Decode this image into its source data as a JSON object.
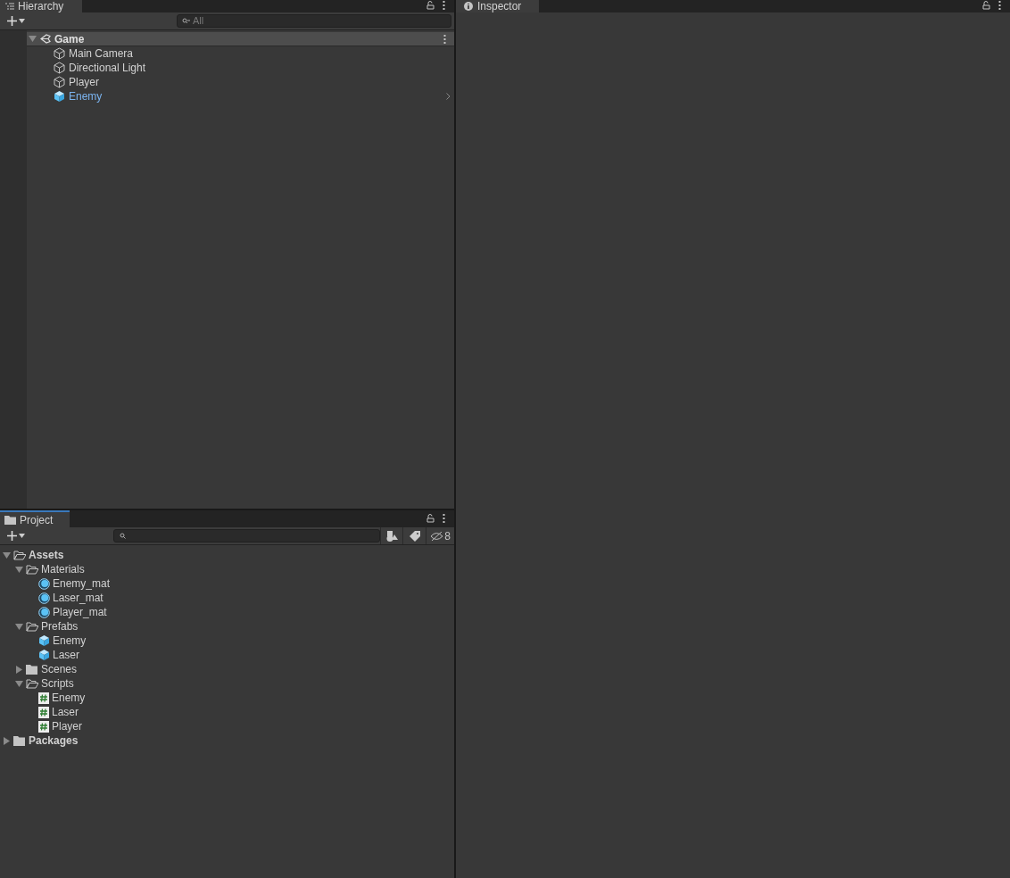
{
  "hierarchy": {
    "tab": "Hierarchy",
    "search": {
      "placeholder": "All"
    },
    "scene": {
      "name": "Game",
      "expanded": true
    },
    "items": [
      {
        "name": "Main Camera",
        "kind": "object"
      },
      {
        "name": "Directional Light",
        "kind": "object"
      },
      {
        "name": "Player",
        "kind": "object"
      },
      {
        "name": "Enemy",
        "kind": "prefab"
      }
    ]
  },
  "project": {
    "tab": "Project",
    "hidden_count": "8",
    "tree": [
      {
        "name": "Assets",
        "kind": "folder",
        "expanded": true,
        "children": [
          {
            "name": "Materials",
            "kind": "folder",
            "expanded": true,
            "children": [
              {
                "name": "Enemy_mat",
                "kind": "material"
              },
              {
                "name": "Laser_mat",
                "kind": "material"
              },
              {
                "name": "Player_mat",
                "kind": "material"
              }
            ]
          },
          {
            "name": "Prefabs",
            "kind": "folder",
            "expanded": true,
            "children": [
              {
                "name": "Enemy",
                "kind": "prefab"
              },
              {
                "name": "Laser",
                "kind": "prefab"
              }
            ]
          },
          {
            "name": "Scenes",
            "kind": "folder",
            "expanded": false
          },
          {
            "name": "Scripts",
            "kind": "folder",
            "expanded": true,
            "children": [
              {
                "name": "Enemy",
                "kind": "script"
              },
              {
                "name": "Laser",
                "kind": "script"
              },
              {
                "name": "Player",
                "kind": "script"
              }
            ]
          }
        ]
      },
      {
        "name": "Packages",
        "kind": "folder",
        "expanded": false
      }
    ]
  },
  "inspector": {
    "tab": "Inspector"
  }
}
